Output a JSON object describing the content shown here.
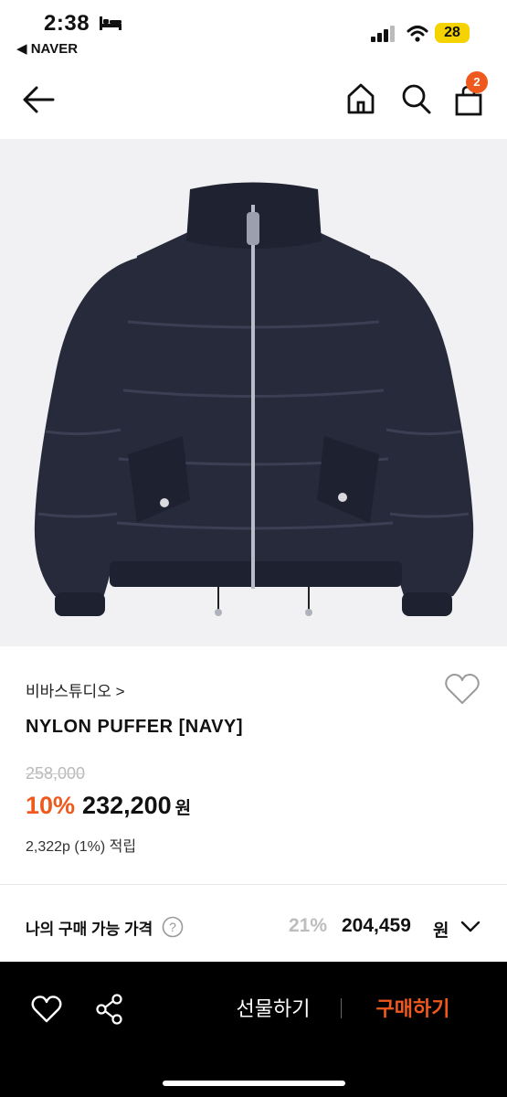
{
  "status_bar": {
    "time": "2:38",
    "back_app": "◀ NAVER",
    "battery": "28"
  },
  "nav": {
    "cart_count": "2"
  },
  "product": {
    "brand": "비바스튜디오 >",
    "title": "NYLON PUFFER [NAVY]",
    "original_price": "258,000",
    "discount_rate": "10%",
    "sale_price": "232,200",
    "currency": "원",
    "points": "2,322p (1%) 적립"
  },
  "my_price": {
    "label": "나의 구매 가능 가격",
    "discount": "21%",
    "price": "204,459",
    "currency": "원"
  },
  "bottom_bar": {
    "gift_label": "선물하기",
    "buy_label": "구매하기"
  },
  "colors": {
    "accent": "#f0591e",
    "jacket": "#262a3b"
  }
}
